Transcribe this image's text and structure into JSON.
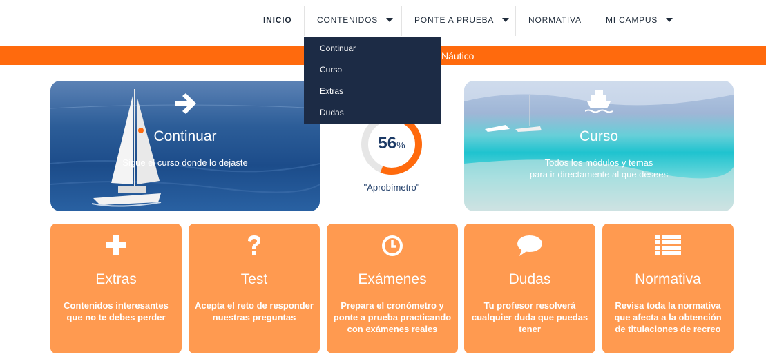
{
  "nav": {
    "items": [
      {
        "label": "INICIO"
      },
      {
        "label": "CONTENIDOS"
      },
      {
        "label": "PONTE A PRUEBA"
      },
      {
        "label": "NORMATIVA"
      },
      {
        "label": "MI CAMPUS"
      }
    ]
  },
  "banner": {
    "text": "Náutico"
  },
  "dropdown": {
    "items": [
      {
        "label": "Continuar"
      },
      {
        "label": "Curso"
      },
      {
        "label": "Extras"
      },
      {
        "label": "Dudas"
      }
    ]
  },
  "hero": {
    "continuar": {
      "title": "Continuar",
      "subtitle": "Sigue el curso donde lo dejaste",
      "icon": "arrow-right-icon"
    },
    "curso": {
      "title": "Curso",
      "subtitle_line1": "Todos los módulos y temas",
      "subtitle_line2": "para ir directamente al que desees",
      "icon": "ship-icon"
    }
  },
  "gauge": {
    "value": "56",
    "unit": "%",
    "progress": 0.56,
    "label": "\"Aprobímetro\""
  },
  "cards": [
    {
      "title": "Extras",
      "desc": "Contenidos interesantes que no te debes perder",
      "icon": "plus-icon"
    },
    {
      "title": "Test",
      "desc": "Acepta el reto de responder nuestras preguntas",
      "icon": "question-icon"
    },
    {
      "title": "Exámenes",
      "desc": "Prepara el cronómetro y ponte a prueba practicando con exámenes reales",
      "icon": "clock-icon"
    },
    {
      "title": "Dudas",
      "desc": "Tu profesor resolverá cualquier duda que puedas tener",
      "icon": "chat-bubble-icon"
    },
    {
      "title": "Normativa",
      "desc": "Revisa toda la normativa que afecta a la obtención de titulaciones de recreo",
      "icon": "list-icon"
    }
  ],
  "colors": {
    "accent": "#ff6a0d",
    "card": "#ff9a50",
    "navy": "#1c2b45"
  }
}
